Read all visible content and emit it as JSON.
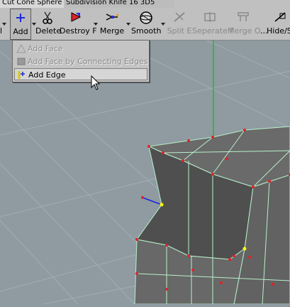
{
  "tabs": [
    "Cut Cone Sphere",
    "Subdivision Knife 16 3D5"
  ],
  "toolbar": {
    "add": "Add",
    "delete": "Delete",
    "destroy": "Destroy F",
    "merge": "Merge",
    "smooth": "Smooth",
    "split": "Split E",
    "separate": "Seperate F",
    "merge_o": "Merge O",
    "hide": "Hide/S"
  },
  "add_menu": {
    "items": [
      {
        "label": "Add Face",
        "enabled": false
      },
      {
        "label": "Add Face by Connecting Edges",
        "enabled": false
      },
      {
        "label": "Add Edge",
        "enabled": true
      }
    ]
  },
  "colors": {
    "viewport_bg": "#8f9aa1",
    "grid_line": "#a7b0b6",
    "toolbar_bg": "#c0c0c0",
    "mesh_face": "#5c5c5c",
    "mesh_edge": "#b7f0ca",
    "vertex": "#e0222a",
    "selected_vertex": "#ffff00",
    "y_axis": "#1ac21a",
    "x_axis": "#1a24e0"
  }
}
